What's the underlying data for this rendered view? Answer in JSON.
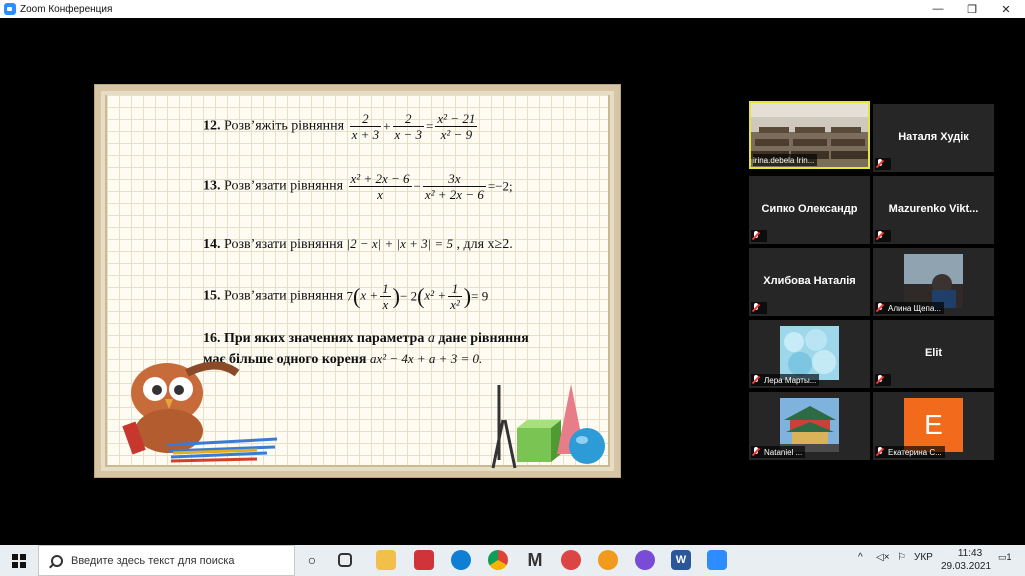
{
  "window": {
    "title": "Zoom Конференция",
    "controls": [
      "—",
      "❐",
      "✕"
    ]
  },
  "slide": {
    "problems": [
      {
        "num": "12.",
        "text": "Розв’яжіть рівняння"
      },
      {
        "num": "13.",
        "text": "Розв’язати рівняння",
        "rhs": "=−2;"
      },
      {
        "num": "14.",
        "text": "Розв’язати рівняння",
        "expr": "|2 − x| + |x + 3| = 5",
        "cond": ", для x≥2."
      },
      {
        "num": "15.",
        "text": "Розв’язати рівняння",
        "rhs": "= 9"
      },
      {
        "num": "16.",
        "line1": "При яких значеннях параметра",
        "param": "a",
        "line1b": "дане рівняння",
        "line2": "має більше одного кореня",
        "expr": "ax² − 4x + a + 3 = 0."
      }
    ],
    "eq12": {
      "f1n": "2",
      "f1d": "x + 3",
      "op1": "+",
      "f2n": "2",
      "f2d": "x − 3",
      "eq": "=",
      "f3n": "x² − 21",
      "f3d": "x² − 9"
    },
    "eq13": {
      "f1n": "x² + 2x − 6",
      "f1d": "x",
      "op": "−",
      "f2n": "3x",
      "f2d": "x² + 2x − 6"
    },
    "eq15": {
      "a": "7",
      "b": "x +",
      "fn1": "1",
      "fd1": "x",
      "c": "− 2",
      "d": "x² +",
      "fn2": "1",
      "fd2": "x²"
    }
  },
  "participants": [
    {
      "name": "irina.debela Irin...",
      "muted": true,
      "video": "classroom",
      "active": true
    },
    {
      "name": "Наталя Худік",
      "muted": true,
      "video": null
    },
    {
      "name": "Сипко Олександр",
      "muted": true,
      "video": null
    },
    {
      "name": "Mazurenko  Vikt...",
      "muted": true,
      "video": null
    },
    {
      "name": "Хлибова Наталія",
      "muted": true,
      "video": null
    },
    {
      "name": "Алина Щепа...",
      "muted": true,
      "video": "photo"
    },
    {
      "name": "Лера Марты...",
      "muted": true,
      "video": "photo"
    },
    {
      "name": "Elit",
      "muted": true,
      "video": null
    },
    {
      "name": "Nataniel ...",
      "muted": true,
      "video": "photo"
    },
    {
      "name": "Екатерина С...",
      "muted": true,
      "video": "avatar",
      "avatar_letter": "E",
      "avatar_color": "#F26B1D"
    }
  ],
  "taskbar": {
    "search_placeholder": "Введите здесь текст для поиска",
    "lang": "УКР",
    "time": "11:43",
    "date": "29.03.2021",
    "notif_count": "1"
  }
}
